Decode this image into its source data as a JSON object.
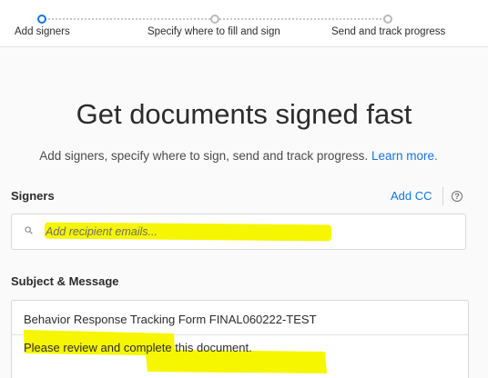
{
  "steps": [
    {
      "label": "Add signers",
      "active": true
    },
    {
      "label": "Specify where to fill and sign",
      "active": false
    },
    {
      "label": "Send and track progress",
      "active": false
    }
  ],
  "main": {
    "title": "Get documents signed fast",
    "subtitle": "Add signers, specify where to sign, send and track progress.",
    "learn_more": "Learn more."
  },
  "signers": {
    "heading": "Signers",
    "add_cc": "Add CC",
    "help_icon": "?",
    "recipient_placeholder": "Add recipient emails..."
  },
  "message": {
    "heading": "Subject & Message",
    "subject": "Behavior Response Tracking Form FINAL060222-TEST",
    "body": "Please review and complete this document."
  },
  "colors": {
    "accent": "#1473e6",
    "highlight": "#f6f600"
  },
  "icons": {
    "search": "search-icon",
    "help": "help-icon"
  }
}
